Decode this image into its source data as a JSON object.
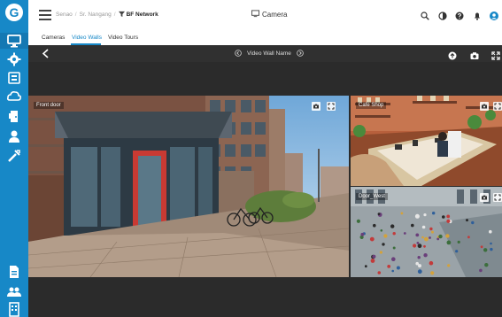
{
  "sidebar": {
    "logo": "G",
    "items": [
      {
        "name": "monitor-icon"
      },
      {
        "name": "gear-icon"
      },
      {
        "name": "card-icon"
      },
      {
        "name": "cloud-icon"
      },
      {
        "name": "door-icon"
      },
      {
        "name": "person-icon"
      },
      {
        "name": "tools-icon"
      },
      {
        "name": "document-icon"
      },
      {
        "name": "people-icon"
      },
      {
        "name": "building-icon"
      }
    ]
  },
  "header": {
    "breadcrumb": [
      "Senao",
      "Sr. Nangang",
      "BF Network"
    ],
    "title": "Camera",
    "actions": [
      "search-icon",
      "contrast-icon",
      "help-icon",
      "bell-icon",
      "user-icon"
    ]
  },
  "tabs": [
    {
      "label": "Cameras",
      "active": false
    },
    {
      "label": "Video Walls",
      "active": true
    },
    {
      "label": "Video Tours",
      "active": false
    }
  ],
  "player": {
    "wall_name": "Video Wall Name",
    "actions": [
      "upload-icon",
      "camera-snapshot-icon",
      "fullscreen-icon"
    ]
  },
  "tiles": [
    {
      "label": "Front door"
    },
    {
      "label": "Cafe Shop"
    },
    {
      "label": "Door_West"
    }
  ],
  "colors": {
    "brand": "#1788c7",
    "player_bg": "#2b2b2b",
    "player_bar": "#303030"
  }
}
